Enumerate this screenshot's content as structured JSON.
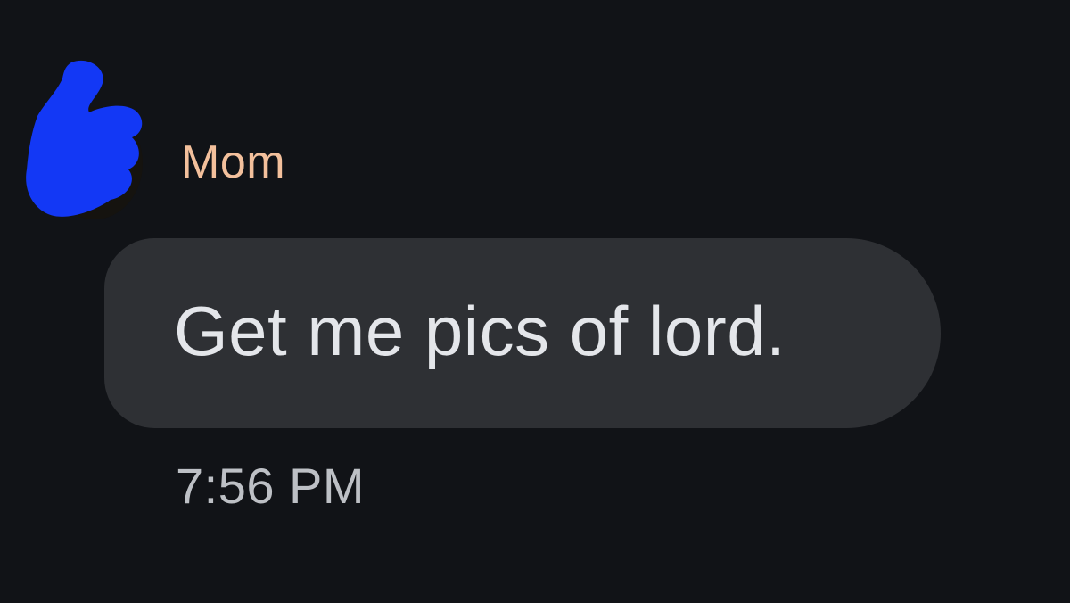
{
  "conversation": {
    "sender": {
      "name": "Mom",
      "name_color": "#f3c09c",
      "avatar_icon": "redacted-avatar-icon",
      "redaction_color": "#1338f5"
    },
    "message": {
      "text": "Get me pics of lord.",
      "timestamp": "7:56 PM",
      "bubble_color": "#2e3034",
      "text_color": "#e4e6ea"
    },
    "background_color": "#111317"
  }
}
